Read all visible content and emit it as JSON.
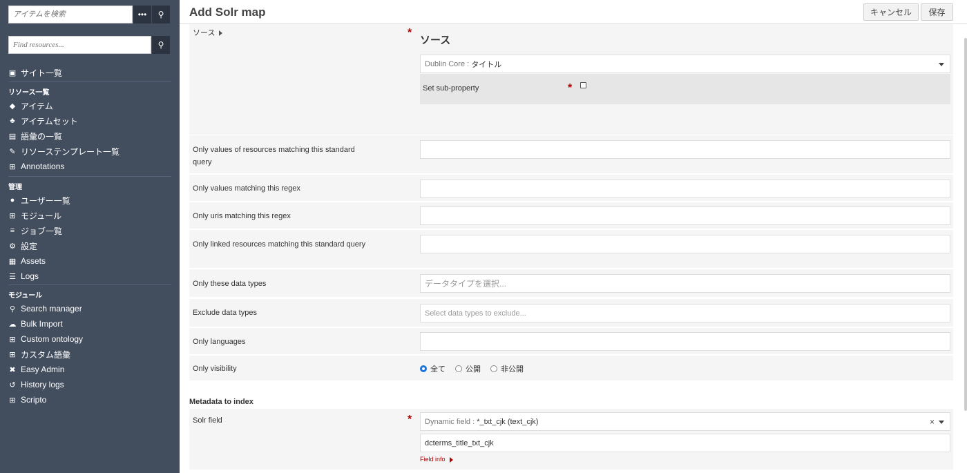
{
  "sidebar": {
    "item_search_placeholder": "アイテムを検索",
    "resource_search_placeholder": "Find resources...",
    "sites_label": "サイト一覧",
    "resources_heading": "リソース一覧",
    "resources": [
      {
        "label": "アイテム",
        "icon": "cube-icon"
      },
      {
        "label": "アイテムセット",
        "icon": "cubes-icon"
      },
      {
        "label": "語彙の一覧",
        "icon": "book-icon"
      },
      {
        "label": "リソーステンプレート一覧",
        "icon": "pencil-square-icon"
      },
      {
        "label": "Annotations",
        "icon": "plus-square-icon"
      }
    ],
    "admin_heading": "管理",
    "admin": [
      {
        "label": "ユーザー一覧",
        "icon": "user-icon"
      },
      {
        "label": "モジュール",
        "icon": "plus-square-icon"
      },
      {
        "label": "ジョブ一覧",
        "icon": "tasks-icon"
      },
      {
        "label": "設定",
        "icon": "cogs-icon"
      },
      {
        "label": "Assets",
        "icon": "image-icon"
      },
      {
        "label": "Logs",
        "icon": "list-icon"
      }
    ],
    "modules_heading": "モジュール",
    "modules": [
      {
        "label": "Search manager",
        "icon": "search-icon"
      },
      {
        "label": "Bulk Import",
        "icon": "cloud-upload-icon"
      },
      {
        "label": "Custom ontology",
        "icon": "plus-square-icon"
      },
      {
        "label": "カスタム語彙",
        "icon": "plus-square-icon"
      },
      {
        "label": "Easy Admin",
        "icon": "tools-icon"
      },
      {
        "label": "History logs",
        "icon": "history-icon"
      },
      {
        "label": "Scripto",
        "icon": "plus-square-icon"
      }
    ]
  },
  "header": {
    "title": "Add Solr map",
    "cancel_label": "キャンセル",
    "save_label": "保存"
  },
  "form": {
    "source_label": "ソース",
    "source_heading": "ソース",
    "source_select_prefix": "Dublin Core :",
    "source_select_value": "タイトル",
    "sub_property_label": "Set sub-property",
    "standard_query_label": "Only values of resources matching this standard query",
    "values_regex_label": "Only values matching this regex",
    "uris_regex_label": "Only uris matching this regex",
    "linked_query_label": "Only linked resources matching this standard query",
    "data_types_label": "Only these data types",
    "data_types_placeholder": "データタイプを選択...",
    "exclude_types_label": "Exclude data types",
    "exclude_types_placeholder": "Select data types to exclude...",
    "languages_label": "Only languages",
    "visibility_label": "Only visibility",
    "visibility_options": [
      "全て",
      "公開",
      "非公開"
    ],
    "visibility_selected": "全て"
  },
  "metadata": {
    "heading": "Metadata to index",
    "solr_field_label": "Solr field",
    "solr_select_prefix": "Dynamic field :",
    "solr_select_value": "*_txt_cjk (text_cjk)",
    "solr_field_value": "dcterms_title_txt_cjk",
    "field_info_label": "Field info"
  },
  "colors": {
    "sidebar_bg": "#424d5e",
    "required": "#aa0000",
    "radio_on": "#1e73d8"
  }
}
